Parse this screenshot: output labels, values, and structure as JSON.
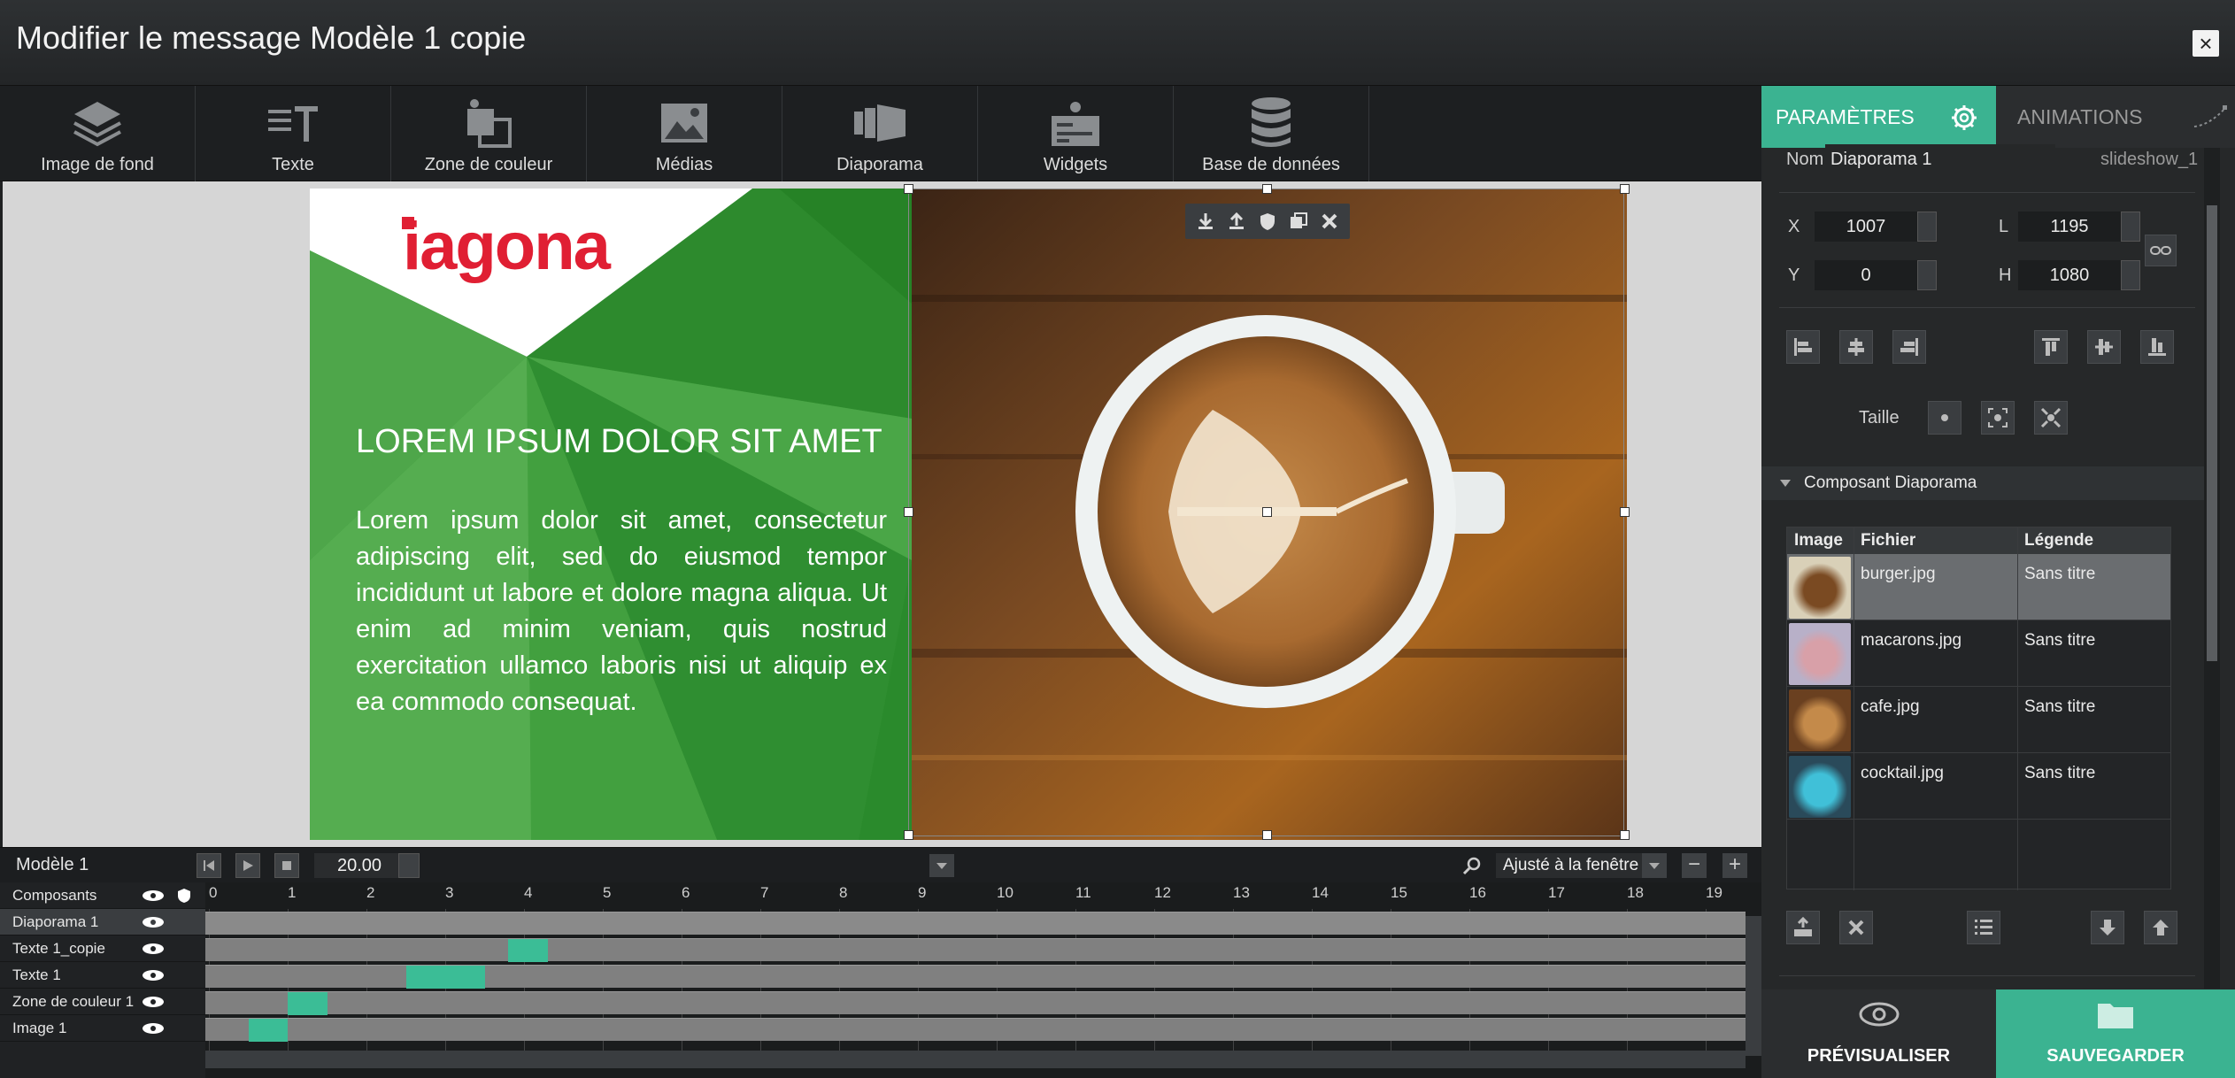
{
  "window": {
    "title": "Modifier le message Modèle 1 copie",
    "close_label": "×"
  },
  "toolbar": {
    "items": [
      {
        "label": "Image de fond",
        "icon": "layers-icon"
      },
      {
        "label": "Texte",
        "icon": "text-icon"
      },
      {
        "label": "Zone de couleur",
        "icon": "color-zone-icon"
      },
      {
        "label": "Médias",
        "icon": "image-icon"
      },
      {
        "label": "Diaporama",
        "icon": "slideshow-icon"
      },
      {
        "label": "Widgets",
        "icon": "widget-icon"
      },
      {
        "label": "Base de données",
        "icon": "database-icon"
      }
    ]
  },
  "artboard": {
    "logo": "iagona",
    "headline": "LOREM IPSUM DOLOR SIT AMET",
    "body": "Lorem ipsum dolor sit amet, consectetur adipiscing elit, sed do eiusmod tempor incididunt ut labore et dolore magna aliqua. Ut enim ad minim veniam, quis nostrud exercitation ullamco laboris nisi ut aliquip ex ea commodo consequat.",
    "colors": {
      "green": "#3a9a3a",
      "brand_red": "#e01f33"
    }
  },
  "timeline": {
    "model_name": "Modèle 1",
    "time_value": "20.00",
    "zoom_label": "Ajusté à la fenêtre",
    "components_header": "Composants",
    "ticks": [
      "0",
      "1",
      "2",
      "3",
      "4",
      "5",
      "6",
      "7",
      "8",
      "9",
      "10",
      "11",
      "12",
      "13",
      "14",
      "15",
      "16",
      "17",
      "18",
      "19"
    ],
    "layers": [
      {
        "name": "Diaporama 1",
        "start": 0,
        "end": 0
      },
      {
        "name": "Texte 1_copie",
        "start": 3.8,
        "end": 4.3
      },
      {
        "name": "Texte 1",
        "start": 2.5,
        "end": 3.5
      },
      {
        "name": "Zone de couleur 1",
        "start": 1.0,
        "end": 1.5
      },
      {
        "name": "Image 1",
        "start": 0.5,
        "end": 1.0
      }
    ],
    "accent": "#3bbd96"
  },
  "panel": {
    "tab_params": "PARAMÈTRES",
    "tab_anim": "ANIMATIONS",
    "name_label": "Nom",
    "name_value": "Diaporama 1",
    "id_value": "slideshow_1",
    "x_label": "X",
    "x_value": "1007",
    "y_label": "Y",
    "y_value": "0",
    "l_label": "L",
    "l_value": "1195",
    "h_label": "H",
    "h_value": "1080",
    "size_label": "Taille",
    "component_header": "Composant Diaporama",
    "table_headers": {
      "image": "Image",
      "file": "Fichier",
      "caption": "Légende"
    },
    "rows": [
      {
        "file": "burger.jpg",
        "caption": "Sans titre"
      },
      {
        "file": "macarons.jpg",
        "caption": "Sans titre"
      },
      {
        "file": "cafe.jpg",
        "caption": "Sans titre"
      },
      {
        "file": "cocktail.jpg",
        "caption": "Sans titre"
      }
    ],
    "preview_label": "PRÉVISUALISER",
    "save_label": "SAUVEGARDER",
    "accent": "#3bb391"
  }
}
